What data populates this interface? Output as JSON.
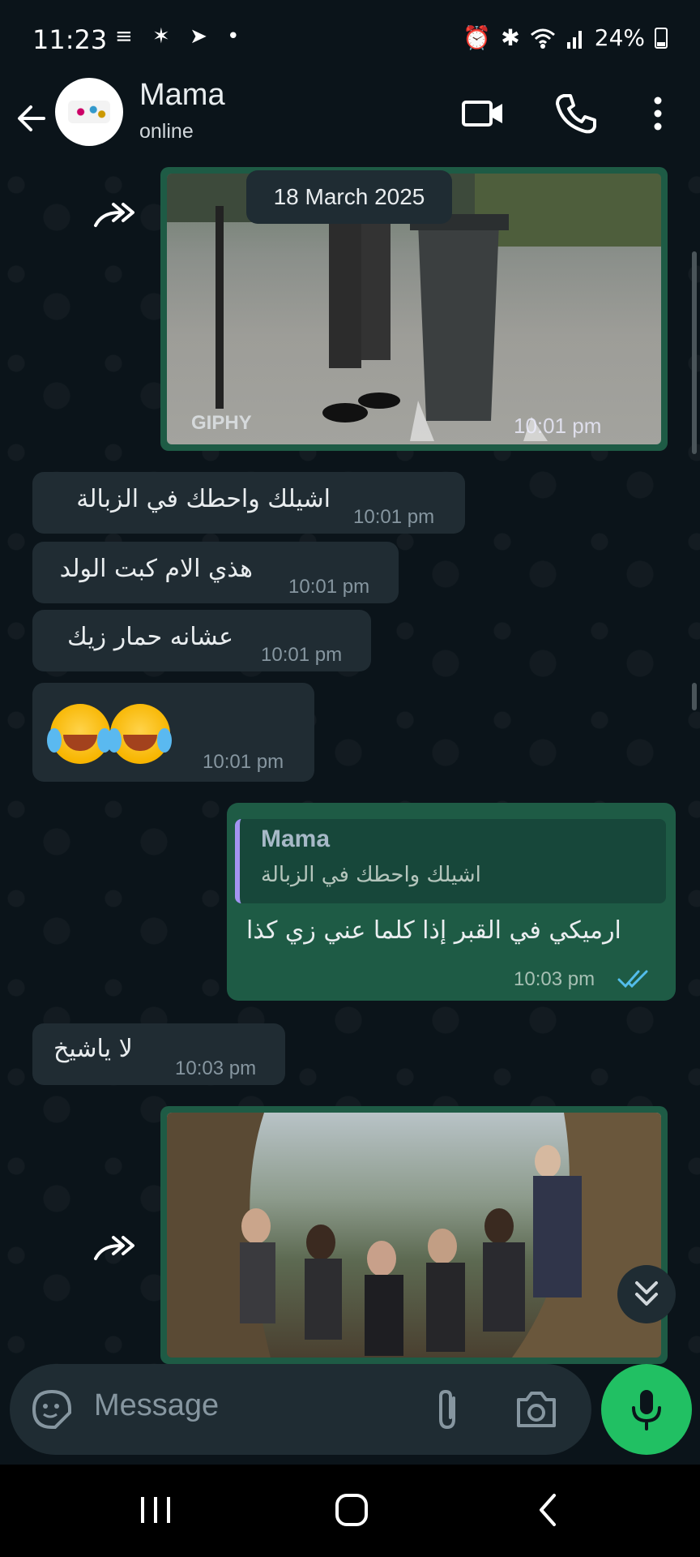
{
  "status_bar": {
    "time": "11:23",
    "left_icons": "≡ ✶ ➤ •",
    "battery": "24%"
  },
  "header": {
    "contact_name": "Mama",
    "contact_status": "online"
  },
  "chat": {
    "date_label": "18 March 2025",
    "gif1": {
      "label": "GIPHY",
      "time": "10:01 pm"
    },
    "incoming": [
      {
        "text": "اشيلك واحطك في الزبالة",
        "time": "10:01 pm"
      },
      {
        "text": "هذي الام كبت الولد",
        "time": "10:01 pm"
      },
      {
        "text": "عشانه حمار زيك",
        "time": "10:01 pm"
      },
      {
        "text": "🤣🤣",
        "time": "10:01 pm"
      }
    ],
    "outgoing_reply": {
      "quote_name": "Mama",
      "quote_text": "اشيلك واحطك في الزبالة",
      "text": "ارميكي في القبر إذا كلما عني زي كذا",
      "time": "10:03 pm"
    },
    "incoming_last": {
      "text": "لا ياشيخ",
      "time": "10:03 pm"
    }
  },
  "composer": {
    "placeholder": "Message"
  },
  "colors": {
    "background": "#0b141a",
    "incoming_bubble": "#202c33",
    "outgoing_bubble": "#1e5b45",
    "mic_button": "#21c063",
    "read_ticks": "#53bdeb"
  },
  "icons": [
    "back-arrow-icon",
    "video-call-icon",
    "phone-icon",
    "more-vertical-icon",
    "forward-icon",
    "sticker-icon",
    "attach-icon",
    "camera-icon",
    "mic-icon",
    "scroll-down-icon",
    "read-ticks-icon"
  ]
}
